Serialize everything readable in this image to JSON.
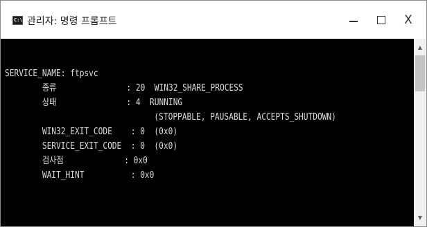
{
  "window": {
    "title": "관리자: 명령 프롬프트",
    "icon_text": "C:\\",
    "controls": {
      "minimize_icon": "minimize-icon",
      "maximize_icon": "maximize-icon",
      "close_label": "X"
    }
  },
  "console": {
    "lines": [
      "SERVICE_NAME: ftpsvc",
      "        종류               : 20  WIN32_SHARE_PROCESS",
      "        상태               : 4  RUNNING",
      "                                (STOPPABLE, PAUSABLE, ACCEPTS_SHUTDOWN)",
      "        WIN32_EXIT_CODE    : 0  (0x0)",
      "        SERVICE_EXIT_CODE  : 0  (0x0)",
      "        검사점             : 0x0",
      "        WAIT_HINT          : 0x0"
    ]
  },
  "colors": {
    "console_background": "#000000",
    "console_text": "#dcdcdc",
    "titlebar_background": "#ffffff"
  }
}
